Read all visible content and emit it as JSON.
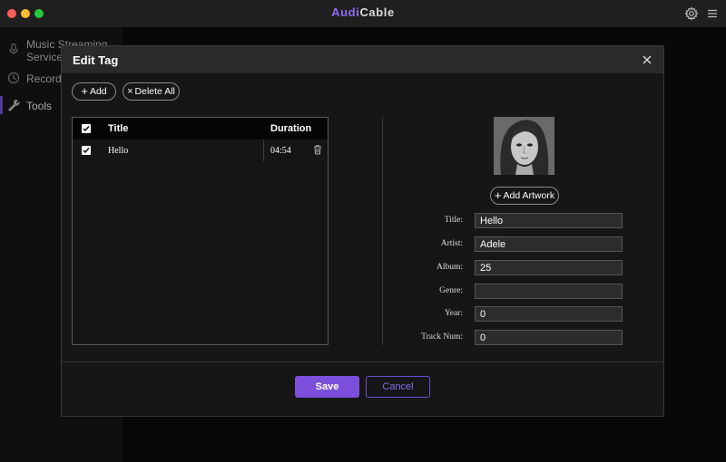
{
  "app": {
    "brand_part1": "Audi",
    "brand_part2": "Cable",
    "accent_color": "#7b4fdc",
    "window_controls": [
      "close",
      "minimize",
      "zoom"
    ],
    "toolbar_icons": [
      "gear-icon",
      "menu-icon"
    ]
  },
  "sidebar": {
    "items": [
      {
        "label_line1": "Music Streaming",
        "label_line2": "Services",
        "icon": "microphone-icon"
      },
      {
        "label": "Recorder",
        "icon": "clock-icon"
      },
      {
        "label": "Tools",
        "icon": "wrench-icon",
        "active": true
      }
    ]
  },
  "dialog": {
    "title": "Edit Tag",
    "add_label": "Add",
    "delete_all_label": "Delete All",
    "table": {
      "headers": {
        "title": "Title",
        "duration": "Duration"
      },
      "rows": [
        {
          "title": "Hello",
          "duration": "04:54",
          "checked": true
        }
      ]
    },
    "add_artwork_label": "Add Artwork",
    "fields": {
      "title": {
        "label": "Title:",
        "value": "Hello"
      },
      "artist": {
        "label": "Artist:",
        "value": "Adele"
      },
      "album": {
        "label": "Album:",
        "value": "25"
      },
      "genre": {
        "label": "Genre:",
        "value": ""
      },
      "year": {
        "label": "Year:",
        "value": "0"
      },
      "track_num": {
        "label": "Track Num:",
        "value": "0"
      }
    },
    "save_label": "Save",
    "cancel_label": "Cancel"
  }
}
